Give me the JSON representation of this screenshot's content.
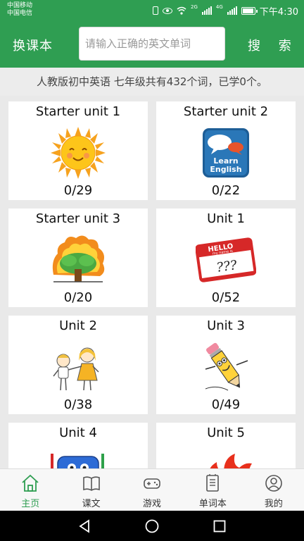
{
  "status_bar": {
    "carrier_1": "中国移动",
    "carrier_2": "中国电信",
    "net_1": "2G",
    "net_2": "4G",
    "time": "下午4:30"
  },
  "header": {
    "switch_label": "换课本",
    "search_placeholder": "请输入正确的英文单词",
    "search_label": "搜 索"
  },
  "summary": "人教版初中英语 七年级共有432个词，已学0个。",
  "units": [
    {
      "title": "Starter unit 1",
      "progress": "0/29",
      "icon": "sun-icon"
    },
    {
      "title": "Starter unit 2",
      "progress": "0/22",
      "icon": "learn-english-icon",
      "icon_text_1": "Learn",
      "icon_text_2": "English"
    },
    {
      "title": "Starter unit 3",
      "progress": "0/20",
      "icon": "burning-tree-icon"
    },
    {
      "title": "Unit 1",
      "progress": "0/52",
      "icon": "hello-name-tag-icon",
      "icon_text_1": "HELLO",
      "icon_text_2": "my name is",
      "icon_text_3": "???"
    },
    {
      "title": "Unit 2",
      "progress": "0/38",
      "icon": "children-icon"
    },
    {
      "title": "Unit 3",
      "progress": "0/49",
      "icon": "pencil-character-icon"
    },
    {
      "title": "Unit 4",
      "progress": "",
      "icon": "schoolbag-icon"
    },
    {
      "title": "Unit 5",
      "progress": "",
      "icon": "fire-icon"
    }
  ],
  "bottom_nav": [
    {
      "label": "主页",
      "icon": "home-icon",
      "active": true
    },
    {
      "label": "课文",
      "icon": "book-icon",
      "active": false
    },
    {
      "label": "游戏",
      "icon": "gamepad-icon",
      "active": false
    },
    {
      "label": "单词本",
      "icon": "notebook-icon",
      "active": false
    },
    {
      "label": "我的",
      "icon": "profile-icon",
      "active": false
    }
  ],
  "colors": {
    "brand_green": "#2f9e52",
    "background": "#e9e9e9",
    "card": "#ffffff"
  }
}
